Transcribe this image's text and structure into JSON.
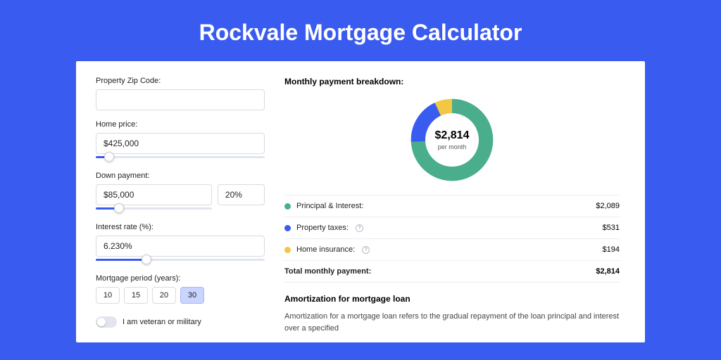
{
  "title": "Rockvale Mortgage Calculator",
  "left": {
    "zip": {
      "label": "Property Zip Code:",
      "value": ""
    },
    "home_price": {
      "label": "Home price:",
      "value": "$425,000",
      "slider_pct": 8
    },
    "down_payment": {
      "label": "Down payment:",
      "value": "$85,000",
      "pct": "20%",
      "slider_pct": 20
    },
    "rate": {
      "label": "Interest rate (%):",
      "value": "6.230%",
      "slider_pct": 30
    },
    "period": {
      "label": "Mortgage period (years):",
      "options": [
        "10",
        "15",
        "20",
        "30"
      ],
      "selected": "30"
    },
    "veteran": {
      "label": "I am veteran or military",
      "on": false
    }
  },
  "breakdown": {
    "title": "Monthly payment breakdown:",
    "center_value": "$2,814",
    "center_label": "per month",
    "items": [
      {
        "name": "Principal & Interest:",
        "amount": "$2,089",
        "color": "#4aae8c",
        "info": false
      },
      {
        "name": "Property taxes:",
        "amount": "$531",
        "color": "#3a5bef",
        "info": true
      },
      {
        "name": "Home insurance:",
        "amount": "$194",
        "color": "#f2c744",
        "info": true
      }
    ],
    "total": {
      "name": "Total monthly payment:",
      "amount": "$2,814"
    }
  },
  "amort": {
    "title": "Amortization for mortgage loan",
    "body": "Amortization for a mortgage loan refers to the gradual repayment of the loan principal and interest over a specified"
  },
  "chart_data": {
    "type": "pie",
    "title": "Monthly payment breakdown",
    "slices": [
      {
        "label": "Principal & Interest",
        "value": 2089,
        "color": "#4aae8c"
      },
      {
        "label": "Property taxes",
        "value": 531,
        "color": "#3a5bef"
      },
      {
        "label": "Home insurance",
        "value": 194,
        "color": "#f2c744"
      }
    ],
    "total": 2814,
    "center_label": "$2,814 per month"
  }
}
